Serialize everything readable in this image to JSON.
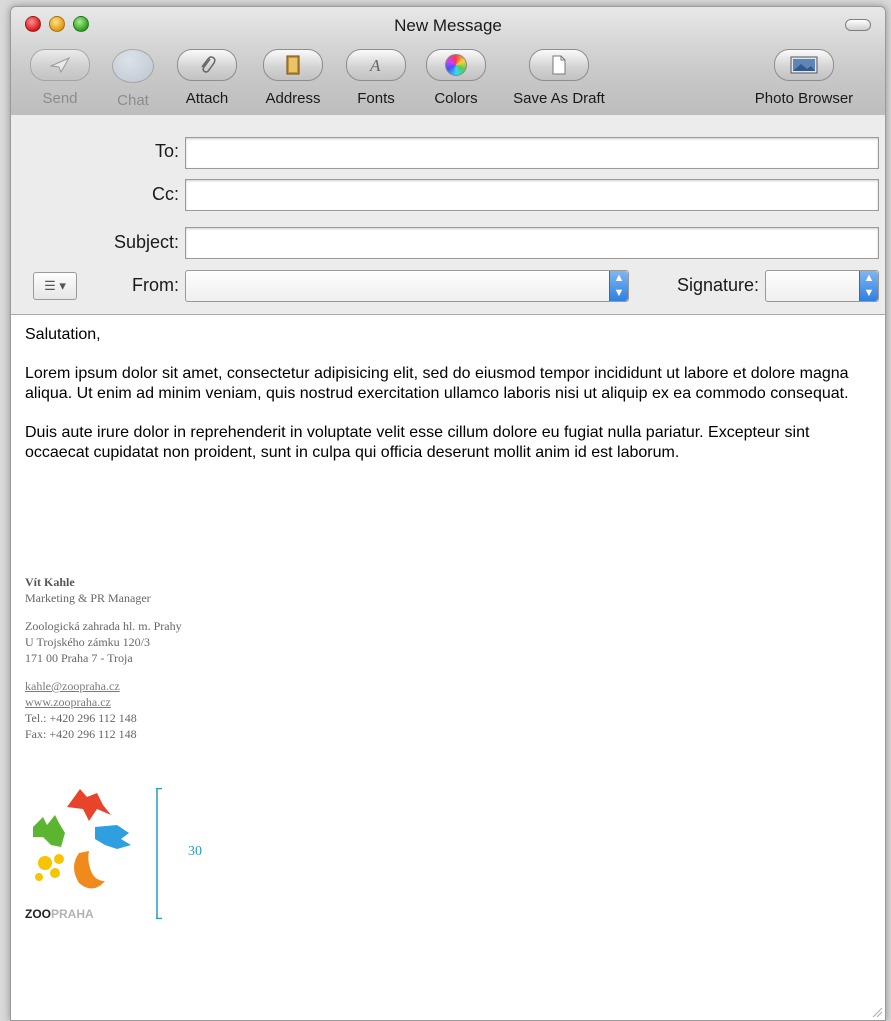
{
  "window": {
    "title": "New Message"
  },
  "toolbar": {
    "items": [
      {
        "label": "Send",
        "icon": "paper-plane-icon",
        "enabled": false
      },
      {
        "label": "Chat",
        "icon": "chat-bubble-icon",
        "enabled": false
      },
      {
        "label": "Attach",
        "icon": "paperclip-icon",
        "enabled": true
      },
      {
        "label": "Address",
        "icon": "address-book-icon",
        "enabled": true
      },
      {
        "label": "Fonts",
        "icon": "font-a-icon",
        "enabled": true
      },
      {
        "label": "Colors",
        "icon": "color-wheel-icon",
        "enabled": true
      },
      {
        "label": "Save As Draft",
        "icon": "document-icon",
        "enabled": true
      },
      {
        "label": "Photo Browser",
        "icon": "photo-icon",
        "enabled": true
      }
    ]
  },
  "header": {
    "to_label": "To:",
    "to_value": "",
    "cc_label": "Cc:",
    "cc_value": "",
    "subject_label": "Subject:",
    "subject_value": "",
    "from_label": "From:",
    "from_value": "",
    "signature_label": "Signature:",
    "signature_value": "",
    "header_menu_icon": "list-menu-icon"
  },
  "message": {
    "salutation": "Salutation,",
    "paragraph1": "Lorem ipsum dolor sit amet, consectetur adipisicing elit, sed do eiusmod tempor incididunt ut labore et dolore magna aliqua. Ut enim ad minim veniam, quis nostrud exercitation ullamco laboris nisi ut aliquip ex ea commodo consequat.",
    "paragraph2": "Duis aute irure dolor in reprehenderit in voluptate velit esse cillum dolore eu fugiat nulla pariatur. Excepteur sint occaecat cupidatat non proident, sunt in culpa qui officia deserunt mollit anim id est laborum."
  },
  "signature": {
    "name": "Vít Kahle",
    "role": "Marketing & PR Manager",
    "org": "Zoologická zahrada hl. m. Prahy",
    "street": "U Trojského zámku 120/3",
    "city": "171 00 Praha 7 - Troja",
    "email": "kahle@zoopraha.cz",
    "web": "www.zoopraha.cz",
    "tel": "Tel.: +420 296 112 148",
    "fax": "Fax: +420 296 112 148",
    "logo_zoo": "ZOO",
    "logo_praha": "PRAHA"
  },
  "annotation": {
    "measure_value": "30",
    "color": "#2a9bc8"
  },
  "colors": {
    "stepper_blue": "#2f7fe0",
    "logo_red": "#e8432b",
    "logo_green": "#5bb531",
    "logo_blue": "#2f9fe0",
    "logo_yellow": "#f6c400",
    "logo_orange": "#f08a1c"
  }
}
